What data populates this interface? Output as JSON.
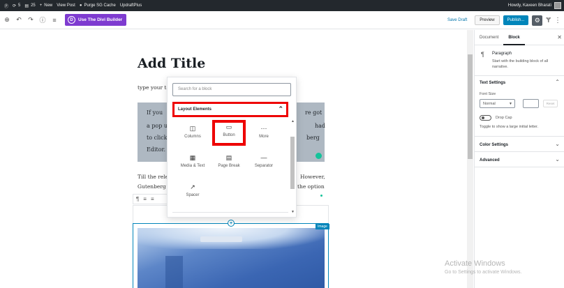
{
  "admin_bar": {
    "updates_count": "5",
    "comments_count": "25",
    "new_label": "New",
    "view_post_label": "View Post",
    "purge_cache_label": "Purge SG Cache",
    "updraft_label": "UpdraftPlus",
    "howdy_label": "Howdy, Kaveen Bharati"
  },
  "toolbar": {
    "divi_logo": "D",
    "divi_label": "Use The Divi Builder",
    "save_draft_label": "Save Draft",
    "preview_label": "Preview",
    "publish_label": "Publish..."
  },
  "editor": {
    "title": "Add Title",
    "para_start": "type your te",
    "gray_lines": [
      "If you",
      "re got",
      "a pop u",
      "had",
      "to click",
      "berg",
      "Editor."
    ],
    "body_lines": [
      "Till the relea",
      "However,",
      "Gutenberg E",
      "the option"
    ]
  },
  "image_block": {
    "label": "Image"
  },
  "inserter": {
    "search_placeholder": "Search for a block",
    "panel_title": "Layout Elements",
    "items": [
      {
        "label": "Columns",
        "icon": "columns-icon"
      },
      {
        "label": "Button",
        "icon": "button-icon"
      },
      {
        "label": "More",
        "icon": "more-icon"
      },
      {
        "label": "Media & Text",
        "icon": "media-text-icon"
      },
      {
        "label": "Page Break",
        "icon": "page-break-icon"
      },
      {
        "label": "Separator",
        "icon": "separator-icon"
      },
      {
        "label": "Spacer",
        "icon": "spacer-icon"
      }
    ]
  },
  "sidebar": {
    "tab_document": "Document",
    "tab_block": "Block",
    "block_title": "Paragraph",
    "block_desc": "Start with the building block of all narrative.",
    "text_settings": "Text Settings",
    "font_size_label": "Font Size",
    "font_size_value": "Normal",
    "reset_label": "Reset",
    "drop_cap_label": "Drop Cap",
    "drop_cap_help": "Toggle to show a large initial letter.",
    "color_settings": "Color Settings",
    "advanced": "Advanced"
  },
  "watermark": {
    "title": "Activate Windows",
    "subtitle": "Go to Settings to activate Windows."
  }
}
